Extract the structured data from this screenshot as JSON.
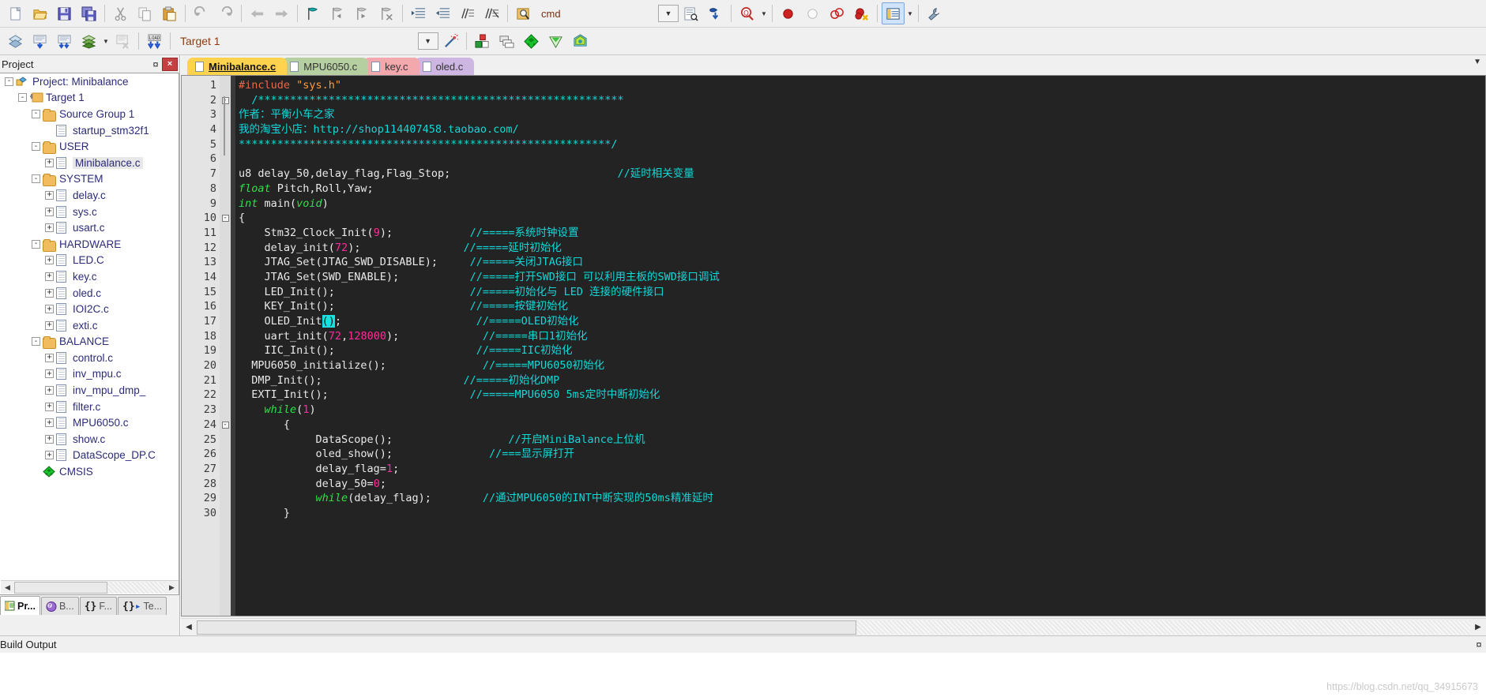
{
  "toolbar_row1": {
    "groups": [
      {
        "buttons": [
          {
            "name": "new-file-icon",
            "label": "New"
          },
          {
            "name": "open-file-icon",
            "label": "Open"
          },
          {
            "name": "save-icon",
            "label": "Save"
          },
          {
            "name": "save-all-icon",
            "label": "Save All"
          }
        ]
      },
      {
        "buttons": [
          {
            "name": "cut-icon",
            "label": "Cut"
          },
          {
            "name": "copy-icon",
            "label": "Copy"
          },
          {
            "name": "paste-icon",
            "label": "Paste"
          }
        ]
      },
      {
        "buttons": [
          {
            "name": "undo-icon",
            "label": "Undo"
          },
          {
            "name": "redo-icon",
            "label": "Redo"
          }
        ]
      },
      {
        "buttons": [
          {
            "name": "navigate-back-icon",
            "label": "Back"
          },
          {
            "name": "navigate-forward-icon",
            "label": "Forward"
          }
        ]
      },
      {
        "buttons": [
          {
            "name": "bookmark-toggle-icon",
            "label": "Insert/Remove Bookmark"
          },
          {
            "name": "bookmark-prev-icon",
            "label": "Previous Bookmark"
          },
          {
            "name": "bookmark-next-icon",
            "label": "Next Bookmark"
          },
          {
            "name": "bookmark-clear-icon",
            "label": "Clear All Bookmarks"
          }
        ]
      },
      {
        "buttons": [
          {
            "name": "indent-right-icon",
            "label": "Indent"
          },
          {
            "name": "indent-left-icon",
            "label": "Outdent"
          },
          {
            "name": "comment-icon",
            "label": "Comment"
          },
          {
            "name": "uncomment-icon",
            "label": "Uncomment"
          }
        ]
      },
      {
        "buttons": [
          {
            "name": "find-in-files-icon",
            "label": "Find in Files"
          }
        ]
      }
    ],
    "command_value": "cmd",
    "after_command_buttons": [
      {
        "name": "incremental-find-icon",
        "label": "Incremental Find"
      },
      {
        "name": "go-to-definition-icon",
        "label": "Go To Definition"
      }
    ],
    "find_button": {
      "name": "find-icon",
      "label": "Find"
    },
    "debug_buttons": [
      {
        "name": "breakpoint-icon",
        "label": "Insert/Remove Breakpoint"
      },
      {
        "name": "disable-breakpoint-icon",
        "label": "Enable/Disable Breakpoint"
      },
      {
        "name": "disable-all-breakpoints-icon",
        "label": "Disable All Breakpoints"
      },
      {
        "name": "kill-all-breakpoints-icon",
        "label": "Kill All Breakpoints"
      }
    ],
    "window_button": {
      "name": "window-layout-icon",
      "label": "Manage Windows"
    },
    "config_button": {
      "name": "wrench-icon",
      "label": "Configuration"
    }
  },
  "toolbar_row2": {
    "buttons": [
      {
        "name": "translate-icon",
        "label": "Translate"
      },
      {
        "name": "build-icon",
        "label": "Build"
      },
      {
        "name": "rebuild-icon",
        "label": "Rebuild"
      },
      {
        "name": "batch-build-icon",
        "label": "Batch Build"
      },
      {
        "name": "stop-build-icon",
        "label": "Stop Build"
      },
      {
        "name": "download-icon",
        "label": "Download"
      }
    ],
    "target_value": "Target 1",
    "target_options": [
      "Target 1"
    ],
    "right_buttons": [
      {
        "name": "magic-wand-icon",
        "label": "Target Options"
      },
      {
        "name": "manage-components-icon",
        "label": "Manage Project Items"
      },
      {
        "name": "multi-project-icon",
        "label": "Multi-Project"
      },
      {
        "name": "pack-installer-icon",
        "label": "Pack Installer"
      },
      {
        "name": "run-to-main-icon",
        "label": "Run to main"
      },
      {
        "name": "pack-manager-icon",
        "label": "Pack Manager"
      }
    ]
  },
  "project_panel": {
    "title": "Project",
    "pin_glyph": "¤",
    "close_glyph": "×",
    "tree": [
      {
        "label": "Project: Minibalance",
        "level": 0,
        "type": "project",
        "expander": "-",
        "selected": false
      },
      {
        "label": "Target 1",
        "level": 1,
        "type": "target",
        "expander": "-",
        "selected": false
      },
      {
        "label": "Source Group 1",
        "level": 2,
        "type": "folder",
        "expander": "-",
        "selected": false
      },
      {
        "label": "startup_stm32f1",
        "level": 3,
        "type": "file",
        "expander": "",
        "selected": false
      },
      {
        "label": "USER",
        "level": 2,
        "type": "folder",
        "expander": "-",
        "selected": false
      },
      {
        "label": "Minibalance.c",
        "level": 3,
        "type": "file",
        "expander": "+",
        "selected": true
      },
      {
        "label": "SYSTEM",
        "level": 2,
        "type": "folder",
        "expander": "-",
        "selected": false
      },
      {
        "label": "delay.c",
        "level": 3,
        "type": "file",
        "expander": "+",
        "selected": false
      },
      {
        "label": "sys.c",
        "level": 3,
        "type": "file",
        "expander": "+",
        "selected": false
      },
      {
        "label": "usart.c",
        "level": 3,
        "type": "file",
        "expander": "+",
        "selected": false
      },
      {
        "label": "HARDWARE",
        "level": 2,
        "type": "folder",
        "expander": "-",
        "selected": false
      },
      {
        "label": "LED.C",
        "level": 3,
        "type": "file",
        "expander": "+",
        "selected": false
      },
      {
        "label": "key.c",
        "level": 3,
        "type": "file",
        "expander": "+",
        "selected": false
      },
      {
        "label": "oled.c",
        "level": 3,
        "type": "file",
        "expander": "+",
        "selected": false
      },
      {
        "label": "IOI2C.c",
        "level": 3,
        "type": "file",
        "expander": "+",
        "selected": false
      },
      {
        "label": "exti.c",
        "level": 3,
        "type": "file",
        "expander": "+",
        "selected": false
      },
      {
        "label": "BALANCE",
        "level": 2,
        "type": "folder",
        "expander": "-",
        "selected": false
      },
      {
        "label": "control.c",
        "level": 3,
        "type": "file",
        "expander": "+",
        "selected": false
      },
      {
        "label": "inv_mpu.c",
        "level": 3,
        "type": "file",
        "expander": "+",
        "selected": false
      },
      {
        "label": "inv_mpu_dmp_",
        "level": 3,
        "type": "file",
        "expander": "+",
        "selected": false
      },
      {
        "label": "filter.c",
        "level": 3,
        "type": "file",
        "expander": "+",
        "selected": false
      },
      {
        "label": "MPU6050.c",
        "level": 3,
        "type": "file",
        "expander": "+",
        "selected": false
      },
      {
        "label": "show.c",
        "level": 3,
        "type": "file",
        "expander": "+",
        "selected": false
      },
      {
        "label": "DataScope_DP.C",
        "level": 3,
        "type": "file",
        "expander": "+",
        "selected": false
      },
      {
        "label": "CMSIS",
        "level": 2,
        "type": "cmsis",
        "expander": "",
        "selected": false
      }
    ],
    "bottom_tabs": [
      {
        "label": "Pr...",
        "icon": "project-icon",
        "active": true
      },
      {
        "label": "B...",
        "icon": "books-icon",
        "active": false
      },
      {
        "label": "F...",
        "icon": "functions-icon",
        "active": false
      },
      {
        "label": "Te...",
        "icon": "templates-icon",
        "active": false
      }
    ]
  },
  "editor": {
    "tabs": [
      {
        "label": "Minibalance.c",
        "active": true
      },
      {
        "label": "MPU6050.c",
        "active": false
      },
      {
        "label": "key.c",
        "active": false
      },
      {
        "label": "oled.c",
        "active": false
      }
    ],
    "dropdown_glyph": "▼",
    "line_numbers": [
      "1",
      "2",
      "3",
      "4",
      "5",
      "6",
      "7",
      "8",
      "9",
      "10",
      "11",
      "12",
      "13",
      "14",
      "15",
      "16",
      "17",
      "18",
      "19",
      "20",
      "21",
      "22",
      "23",
      "24",
      "25",
      "26",
      "27",
      "28",
      "29",
      "30"
    ],
    "fold_markers": {
      "2": "-",
      "10": "-",
      "24": "-"
    },
    "lines": [
      [
        {
          "t": "#include ",
          "c": "pre"
        },
        {
          "t": "\"sys.h\"",
          "c": "str"
        }
      ],
      [
        {
          "t": "  /*********************************************************",
          "c": "cmt"
        }
      ],
      [
        {
          "t": "作者：平衡小车之家",
          "c": "cmt"
        }
      ],
      [
        {
          "t": "我的淘宝小店：http://shop114407458.taobao.com/",
          "c": "cmt"
        }
      ],
      [
        {
          "t": "**********************************************************/",
          "c": "cmt"
        }
      ],
      [],
      [
        {
          "t": "u8 delay_50,delay_flag,Flag_Stop;",
          "c": "txt"
        },
        {
          "t": "                          ",
          "c": "txt"
        },
        {
          "t": "//延时相关变量",
          "c": "cmt"
        }
      ],
      [
        {
          "t": "float",
          "c": "kw"
        },
        {
          "t": " Pitch,Roll,Yaw;",
          "c": "txt"
        }
      ],
      [
        {
          "t": "int",
          "c": "kw"
        },
        {
          "t": " main(",
          "c": "txt"
        },
        {
          "t": "void",
          "c": "kw"
        },
        {
          "t": ")",
          "c": "txt"
        }
      ],
      [
        {
          "t": "{",
          "c": "txt"
        }
      ],
      [
        {
          "t": "    Stm32_Clock_Init(",
          "c": "txt"
        },
        {
          "t": "9",
          "c": "num"
        },
        {
          "t": ");",
          "c": "txt"
        },
        {
          "t": "            ",
          "c": "txt"
        },
        {
          "t": "//=====系统时钟设置",
          "c": "cmt"
        }
      ],
      [
        {
          "t": "    delay_init(",
          "c": "txt"
        },
        {
          "t": "72",
          "c": "num"
        },
        {
          "t": ");",
          "c": "txt"
        },
        {
          "t": "                ",
          "c": "txt"
        },
        {
          "t": "//=====延时初始化",
          "c": "cmt"
        }
      ],
      [
        {
          "t": "    JTAG_Set(JTAG_SWD_DISABLE);",
          "c": "txt"
        },
        {
          "t": "     ",
          "c": "txt"
        },
        {
          "t": "//=====关闭JTAG接口",
          "c": "cmt"
        }
      ],
      [
        {
          "t": "    JTAG_Set(SWD_ENABLE);",
          "c": "txt"
        },
        {
          "t": "           ",
          "c": "txt"
        },
        {
          "t": "//=====打开SWD接口 可以利用主板的SWD接口调试",
          "c": "cmt"
        }
      ],
      [
        {
          "t": "    LED_Init();",
          "c": "txt"
        },
        {
          "t": "                     ",
          "c": "txt"
        },
        {
          "t": "//=====初始化与 LED 连接的硬件接口",
          "c": "cmt"
        }
      ],
      [
        {
          "t": "    KEY_Init();",
          "c": "txt"
        },
        {
          "t": "                     ",
          "c": "txt"
        },
        {
          "t": "//=====按键初始化",
          "c": "cmt"
        }
      ],
      [
        {
          "t": "    OLED_Init",
          "c": "txt"
        },
        {
          "t": "()",
          "c": "hl"
        },
        {
          "t": ";",
          "c": "txt"
        },
        {
          "t": "                     ",
          "c": "txt"
        },
        {
          "t": "//=====OLED初始化",
          "c": "cmt"
        }
      ],
      [
        {
          "t": "    uart_init(",
          "c": "txt"
        },
        {
          "t": "72",
          "c": "num"
        },
        {
          "t": ",",
          "c": "txt"
        },
        {
          "t": "128000",
          "c": "num"
        },
        {
          "t": ");",
          "c": "txt"
        },
        {
          "t": "             ",
          "c": "txt"
        },
        {
          "t": "//=====串口1初始化",
          "c": "cmt"
        }
      ],
      [
        {
          "t": "    IIC_Init();",
          "c": "txt"
        },
        {
          "t": "                      ",
          "c": "txt"
        },
        {
          "t": "//=====IIC初始化",
          "c": "cmt"
        }
      ],
      [
        {
          "t": "  MPU6050_initialize();",
          "c": "txt"
        },
        {
          "t": "               ",
          "c": "txt"
        },
        {
          "t": "//=====MPU6050初始化",
          "c": "cmt"
        }
      ],
      [
        {
          "t": "  DMP_Init();",
          "c": "txt"
        },
        {
          "t": "                      ",
          "c": "txt"
        },
        {
          "t": "//=====初始化DMP",
          "c": "cmt"
        }
      ],
      [
        {
          "t": "  EXTI_Init();",
          "c": "txt"
        },
        {
          "t": "                      ",
          "c": "txt"
        },
        {
          "t": "//=====MPU6050 5ms定时中断初始化",
          "c": "cmt"
        }
      ],
      [
        {
          "t": "    ",
          "c": "txt"
        },
        {
          "t": "while",
          "c": "kw"
        },
        {
          "t": "(",
          "c": "txt"
        },
        {
          "t": "1",
          "c": "num"
        },
        {
          "t": ")",
          "c": "txt"
        }
      ],
      [
        {
          "t": "       {",
          "c": "txt"
        }
      ],
      [
        {
          "t": "            DataScope();",
          "c": "txt"
        },
        {
          "t": "                  ",
          "c": "txt"
        },
        {
          "t": "//开启MiniBalance上位机",
          "c": "cmt"
        }
      ],
      [
        {
          "t": "            oled_show();",
          "c": "txt"
        },
        {
          "t": "               ",
          "c": "txt"
        },
        {
          "t": "//===显示屏打开",
          "c": "cmt"
        }
      ],
      [
        {
          "t": "            delay_flag=",
          "c": "txt"
        },
        {
          "t": "1",
          "c": "num"
        },
        {
          "t": ";",
          "c": "txt"
        }
      ],
      [
        {
          "t": "            delay_50=",
          "c": "txt"
        },
        {
          "t": "0",
          "c": "num"
        },
        {
          "t": ";",
          "c": "txt"
        }
      ],
      [
        {
          "t": "            ",
          "c": "txt"
        },
        {
          "t": "while",
          "c": "kw"
        },
        {
          "t": "(delay_flag);",
          "c": "txt"
        },
        {
          "t": "        ",
          "c": "txt"
        },
        {
          "t": "//通过MPU6050的INT中断实现的50ms精准延时",
          "c": "cmt"
        }
      ],
      [
        {
          "t": "       }",
          "c": "txt"
        }
      ]
    ]
  },
  "build_output": {
    "title": "Build Output",
    "pin_glyph": "¤",
    "content": ""
  },
  "watermark": "https://blog.csdn.net/qq_34915673",
  "colors": {
    "editor_bg": "#232323",
    "comment": "#13d7d7",
    "keyword": "#2fe04a",
    "number": "#ff2a9e",
    "string": "#ff9a3c",
    "preproc": "#e86a4a",
    "bracket_highlight": "#19e0e0",
    "active_tab": "#ffd34d"
  }
}
